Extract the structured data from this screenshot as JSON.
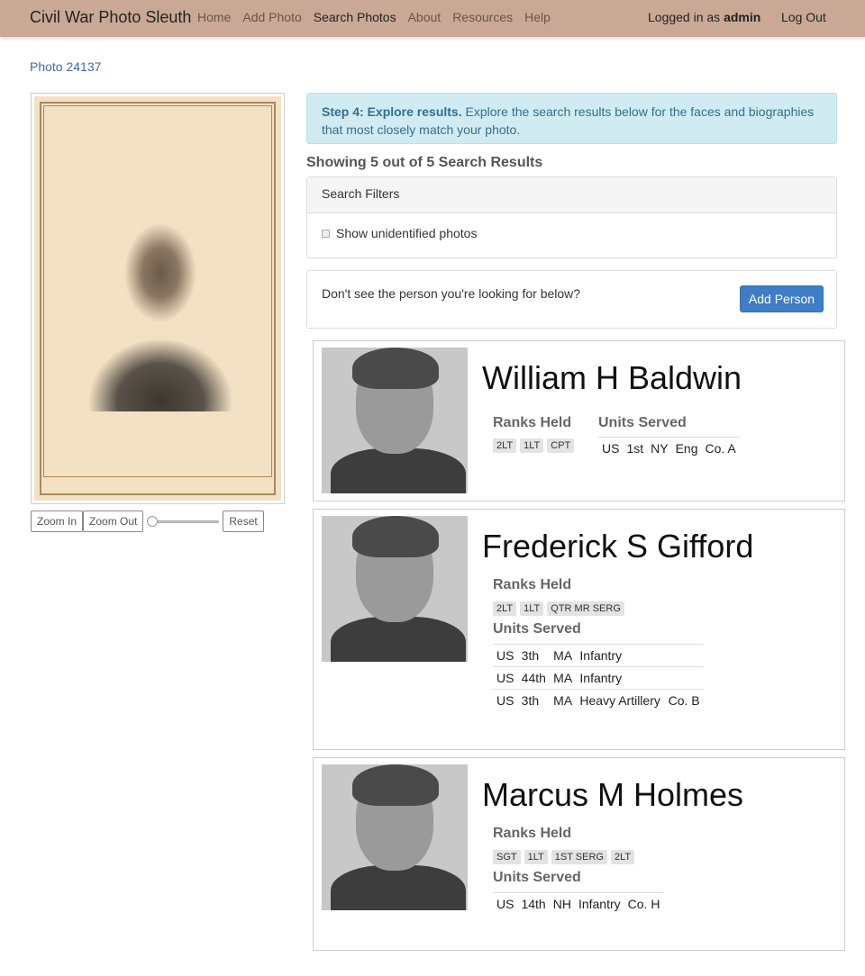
{
  "navbar": {
    "brand": "Civil War Photo Sleuth",
    "links": [
      "Home",
      "Add Photo",
      "Search Photos",
      "About",
      "Resources",
      "Help"
    ],
    "active_link": "Search Photos",
    "logged_in_prefix": "Logged in as",
    "username": "admin",
    "logout": "Log Out"
  },
  "breadcrumb": "Photo 24137",
  "viewer": {
    "zoom_in": "Zoom In",
    "zoom_out": "Zoom Out",
    "reset": "Reset",
    "zoom_level": 0
  },
  "alert": {
    "step": "Step 4: Explore results.",
    "text": "Explore the search results below for the faces and biographies that most closely match your photo."
  },
  "results_count": "Showing 5 out of 5 Search Results",
  "filters": {
    "title": "Search Filters",
    "show_unidentified_label": "Show unidentified photos",
    "show_unidentified_checked": false
  },
  "add_person": {
    "prompt": "Don't see the person you're looking for below?",
    "button": "Add Person"
  },
  "labels": {
    "ranks_held": "Ranks Held",
    "units_served": "Units Served"
  },
  "results": [
    {
      "name": "William H Baldwin",
      "ranks": [
        "2LT",
        "1LT",
        "CPT"
      ],
      "units": [
        [
          "US",
          "1st",
          "NY",
          "Eng",
          "Co. A"
        ]
      ]
    },
    {
      "name": "Frederick S Gifford",
      "ranks": [
        "2LT",
        "1LT",
        "QTR MR SERG"
      ],
      "units": [
        [
          "US",
          "3th",
          "MA",
          "Infantry",
          ""
        ],
        [
          "US",
          "44th",
          "MA",
          "Infantry",
          ""
        ],
        [
          "US",
          "3th",
          "MA",
          "Heavy Artillery",
          "Co. B"
        ]
      ]
    },
    {
      "name": "Marcus M Holmes",
      "ranks": [
        "SGT",
        "1LT",
        "1ST SERG",
        "2LT"
      ],
      "units": [
        [
          "US",
          "14th",
          "NH",
          "Infantry",
          "Co. H"
        ]
      ]
    }
  ]
}
